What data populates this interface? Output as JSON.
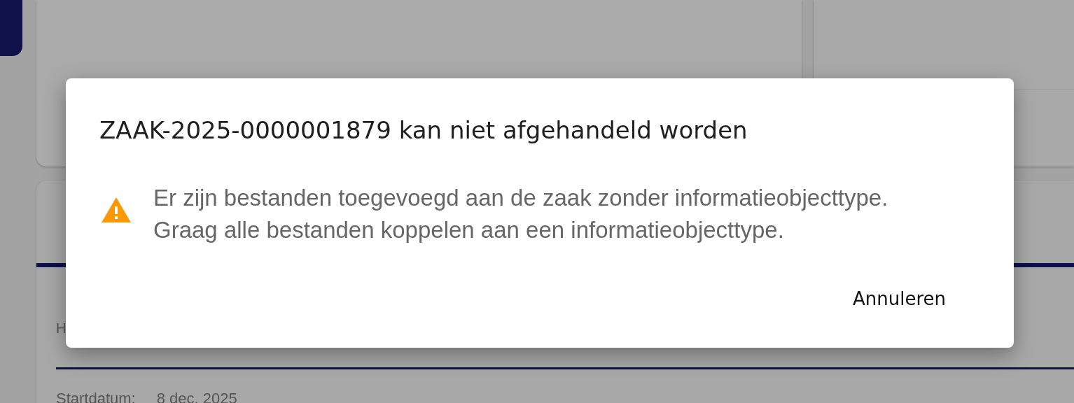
{
  "background": {
    "section_heading": "H",
    "fields": [
      {
        "label": "Startdatum:",
        "value": "8 dec. 2025"
      }
    ]
  },
  "dialog": {
    "title": "ZAAK-2025-0000001879 kan niet afgehandeld worden",
    "kind": "warning",
    "message": [
      "Er zijn bestanden toegevoegd aan de zaak zonder informatieobjecttype.",
      "Graag alle bestanden koppelen aan een informatieobjecttype."
    ],
    "buttons": [
      "Annuleren"
    ]
  }
}
